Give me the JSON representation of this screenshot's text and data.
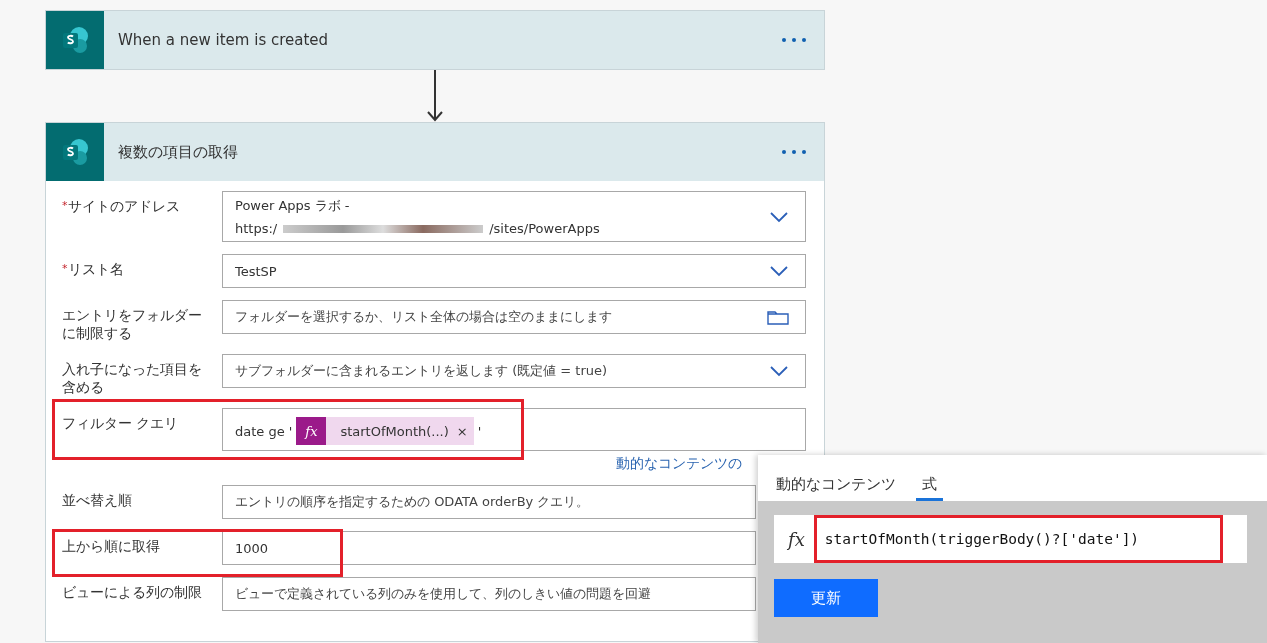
{
  "flow": [
    {
      "kind": "trigger",
      "title": "When a new item is created"
    },
    {
      "kind": "action",
      "title": "複数の項目の取得",
      "fields": [
        {
          "label": "サイトのアドレス",
          "mark": "*",
          "kind": "dropdown",
          "site": {
            "name": "Power Apps ラボ -",
            "url_start": "https:/",
            "url_end": "/sites/PowerApps"
          }
        },
        {
          "label": "リスト名",
          "mark": "*",
          "kind": "dropdown",
          "value": "TestSP"
        },
        {
          "label": "エントリをフォルダーに制限する",
          "kind": "picker",
          "placeholder": "フォルダーを選択するか、リスト全体の場合は空のままにします"
        },
        {
          "label": "入れ子になった項目を含める",
          "kind": "dropdown",
          "placeholder": "サブフォルダーに含まれるエントリを返します (既定値 = true)"
        },
        {
          "label": "フィルター クエリ",
          "kind": "expression",
          "highlighted": true,
          "prefix": "date ge '",
          "token": {
            "icon": "fx",
            "label": "startOfMonth(...)",
            "close": "×"
          },
          "suffix": "'",
          "link": "動的なコンテンツの"
        },
        {
          "label": "並べ替え順",
          "kind": "text",
          "placeholder": "エントリの順序を指定するための ODATA orderBy クエリ。"
        },
        {
          "label": "上から順に取得",
          "kind": "text",
          "highlighted": true,
          "value": "1000"
        },
        {
          "label": "ビューによる列の制限",
          "kind": "text",
          "placeholder": "ビューで定義されている列のみを使用して、列のしきい値の問題を回避"
        }
      ]
    }
  ],
  "popup": {
    "tabs": [
      {
        "label": "動的なコンテンツ",
        "selected": false
      },
      {
        "label": "式",
        "selected": true
      }
    ],
    "expression": {
      "icon": "fx",
      "value": "startOfMonth(triggerBody()?['date'])",
      "highlighted": true
    },
    "button": "更新"
  }
}
